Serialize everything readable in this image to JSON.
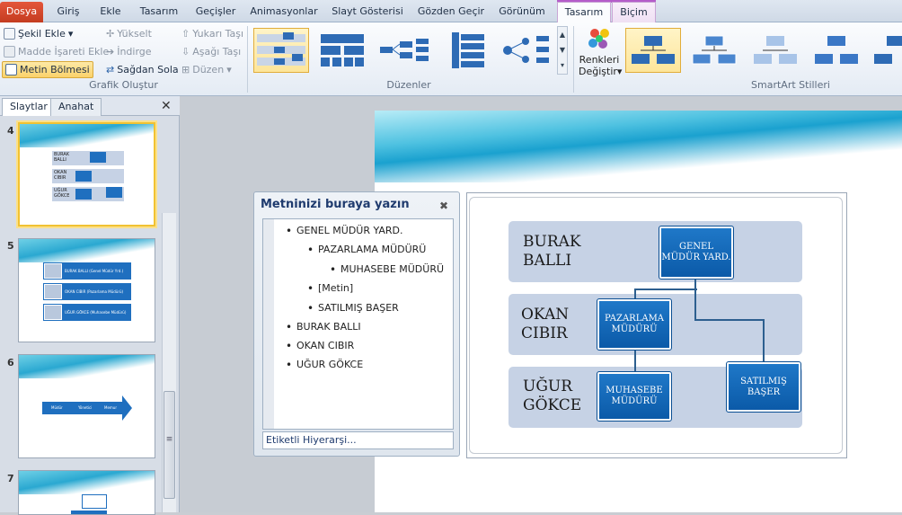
{
  "tabs": {
    "file": "Dosya",
    "home": "Giriş",
    "insert": "Ekle",
    "design": "Tasarım",
    "transitions": "Geçişler",
    "animations": "Animasyonlar",
    "slideshow": "Slayt Gösterisi",
    "review": "Gözden Geçir",
    "view": "Görünüm",
    "smartart_design": "Tasarım",
    "format": "Biçim"
  },
  "ribbon": {
    "create_graphic": {
      "add_shape": "Şekil Ekle",
      "add_bullet": "Madde İşareti Ekle",
      "text_pane": "Metin Bölmesi",
      "promote": "Yükselt",
      "demote": "İndirge",
      "right_to_left": "Sağdan Sola",
      "move_up": "Yukarı Taşı",
      "move_down": "Aşağı Taşı",
      "layout": "Düzen",
      "label": "Grafik Oluştur"
    },
    "layouts": {
      "label": "Düzenler"
    },
    "styles": {
      "change_colors_1": "Renkleri",
      "change_colors_2": "Değiştir",
      "label": "SmartArt Stilleri"
    },
    "colors": {
      "accent": "#0b5aa8",
      "selection": "#fde59a"
    }
  },
  "leftpane": {
    "tab_slides": "Slaytlar",
    "tab_outline": "Anahat",
    "slides": [
      {
        "num": "4"
      },
      {
        "num": "5"
      },
      {
        "num": "6"
      },
      {
        "num": "7"
      }
    ],
    "thumb4": {
      "l1": "BURAK BALLI",
      "l2": "OKAN CIBIR",
      "l3": "UĞUR GÖKCE"
    },
    "thumb5": {
      "r1": "BURAK BALLI (Genel Müdür Yrd.)",
      "r2": "OKAN CIBIR (Pazarlama Müdürü)",
      "r3": "UĞUR GÖKCE (Muhasebe Müdürü)"
    },
    "thumb6": {
      "a1": "Müdür",
      "a2": "Yönetici",
      "a3": "Memur"
    }
  },
  "textpane": {
    "title": "Metninizi buraya yazın",
    "items": [
      "GENEL MÜDÜR YARD.",
      "PAZARLAMA MÜDÜRÜ",
      "MUHASEBE MÜDÜRÜ",
      "[Metin]",
      "SATILMIŞ BAŞER",
      "BURAK BALLI",
      "OKAN CIBIR",
      "UĞUR GÖKCE"
    ],
    "footer": "Etiketli Hiyerarşi..."
  },
  "smartart": {
    "band1": "BURAK BALLI",
    "band2": "OKAN CIBIR",
    "band3": "UĞUR GÖKCE",
    "node_gm": "GENEL MÜDÜR YARD.",
    "node_pm": "PAZARLAMA MÜDÜRÜ",
    "node_mm": "MUHASEBE MÜDÜRÜ",
    "node_sb": "SATILMIŞ BAŞER"
  }
}
